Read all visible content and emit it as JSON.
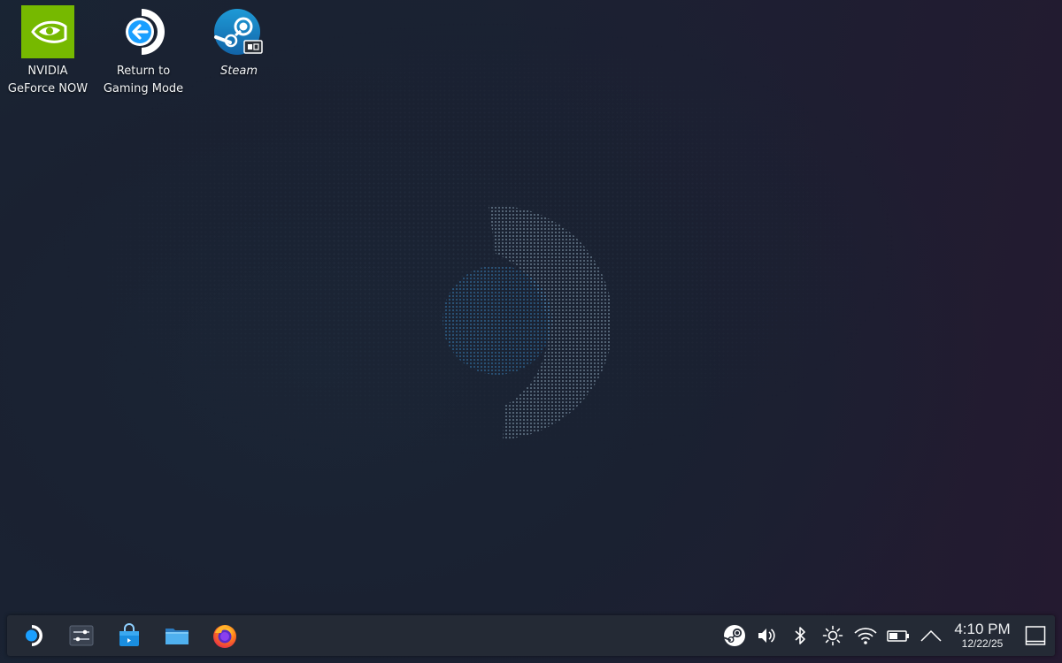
{
  "desktop": {
    "icons": [
      {
        "id": "geforce-now",
        "label_line1": "NVIDIA",
        "label_line2": "GeForce NOW",
        "icon": "nvidia-icon",
        "color": "#76b900"
      },
      {
        "id": "return-gaming",
        "label_line1": "Return to",
        "label_line2": "Gaming Mode",
        "icon": "return-arrow-icon",
        "color": "#1a9fff"
      },
      {
        "id": "steam",
        "label_line1": "Steam",
        "label_line2": "",
        "icon": "steam-icon",
        "color": "#1b75bb"
      }
    ]
  },
  "taskbar": {
    "launchers": [
      {
        "id": "app-launcher",
        "icon": "steamos-logo-icon"
      },
      {
        "id": "system-settings",
        "icon": "settings-sliders-icon"
      },
      {
        "id": "discover",
        "icon": "store-bag-icon"
      },
      {
        "id": "dolphin",
        "icon": "folder-icon"
      },
      {
        "id": "firefox",
        "icon": "firefox-icon"
      }
    ],
    "tray": [
      {
        "id": "steam-tray",
        "icon": "steam-icon"
      },
      {
        "id": "volume",
        "icon": "speaker-icon"
      },
      {
        "id": "bluetooth",
        "icon": "bluetooth-icon"
      },
      {
        "id": "brightness",
        "icon": "brightness-icon"
      },
      {
        "id": "wifi",
        "icon": "wifi-icon"
      },
      {
        "id": "battery",
        "icon": "battery-icon"
      },
      {
        "id": "tray-expand",
        "icon": "chevron-up-icon"
      }
    ],
    "clock": {
      "time": "4:10 PM",
      "date": "12/22/25"
    },
    "show_desktop": {
      "icon": "show-desktop-icon"
    }
  },
  "colors": {
    "accent": "#1a9fff",
    "nvidia_green": "#76b900",
    "taskbar_bg": "#242a35"
  }
}
